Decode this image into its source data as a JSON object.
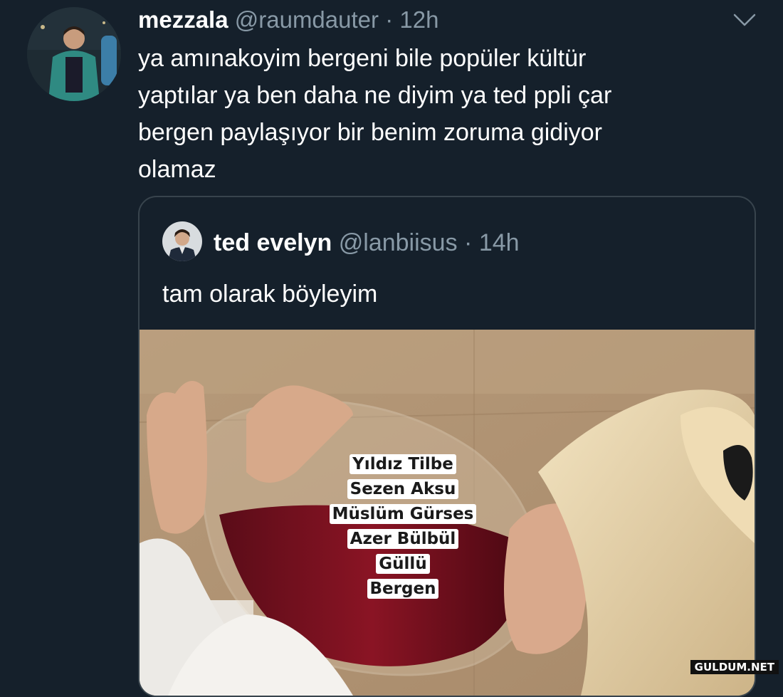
{
  "tweet": {
    "author": {
      "name": "mezzala",
      "handle": "@raumdauter",
      "separator": "·",
      "time": "12h"
    },
    "text_lines": [
      "ya amınakoyim bergeni bile popüler kültür",
      "yaptılar ya ben daha ne diyim ya ted ppli çar",
      "bergen paylaşıyor bir benim zoruma gidiyor",
      "olamaz"
    ],
    "menu_icon": "chevron-down-icon"
  },
  "quoted_tweet": {
    "author": {
      "name": "ted evelyn",
      "handle": "@lanbiisus",
      "separator": "·",
      "time": "14h"
    },
    "text": "tam olarak böyleyim",
    "image": {
      "captions": [
        "Yıldız Tilbe",
        "Sezen Aksu",
        "Müslüm Gürses",
        "Azer Bülbül",
        "Güllü",
        "Bergen"
      ]
    }
  },
  "watermark": "GULDUM.NET",
  "colors": {
    "background": "#15202b",
    "border": "#38444d",
    "secondary_text": "#8899a6",
    "wine": "#7a1020"
  }
}
